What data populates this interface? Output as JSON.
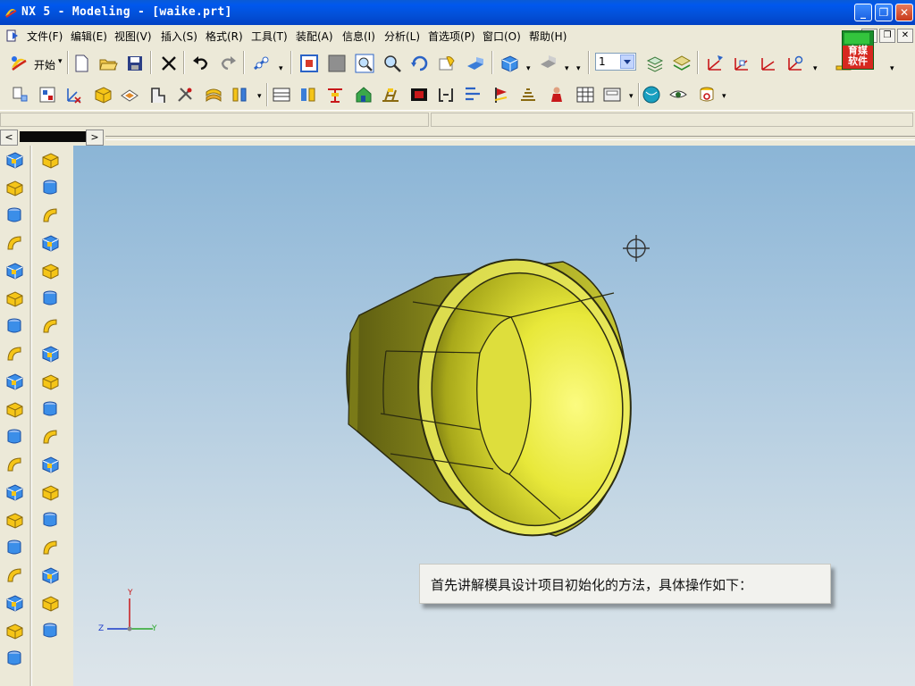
{
  "window": {
    "title": "NX 5 - Modeling - [waike.prt]",
    "buttons": [
      "_",
      "❐",
      "✕"
    ]
  },
  "menubar": {
    "items": [
      "文件(F)",
      "编辑(E)",
      "视图(V)",
      "插入(S)",
      "格式(R)",
      "工具(T)",
      "装配(A)",
      "信息(I)",
      "分析(L)",
      "首选项(P)",
      "窗口(O)",
      "帮助(H)"
    ]
  },
  "brand_badge": {
    "text": "育媒\n软件"
  },
  "toolbar1": {
    "start_label": "开始",
    "layer_value": "1",
    "icons": [
      "start-icon",
      "new-file-icon",
      "open-folder-icon",
      "save-icon",
      "delete-icon",
      "undo-icon",
      "redo-icon",
      "snap-icon",
      "fit-icon",
      "zoom-window-icon",
      "zoom-icon",
      "rotate-icon",
      "pan-icon",
      "perspective-icon",
      "shaded-cube-icon",
      "render-style-icon",
      "layer-settings-icon",
      "layer-visible-icon",
      "wcs-origin-icon",
      "wcs-dynamic-icon",
      "wcs-rotate-icon",
      "wcs-orient-icon",
      "brand-icon"
    ]
  },
  "toolbar2": {
    "icons": [
      "sketch-tool-icon",
      "extract-icon",
      "datum-csys-icon",
      "box-feature-icon",
      "plane-icon",
      "trim-icon",
      "tools-icon",
      "sheet-icon",
      "measure-icon",
      "section-icon",
      "pattern-icon",
      "cut-icon",
      "house-icon",
      "ladder-icon",
      "film-icon",
      "bracket-icon",
      "align-icon",
      "flag-icon",
      "stack-icon",
      "person-icon",
      "grid-icon",
      "frame-icon",
      "globe-icon",
      "eye-icon",
      "refresh-icon"
    ]
  },
  "left_palette": {
    "col1": [
      "sketch-icon",
      "extrude-icon",
      "revolve-icon",
      "sweep-icon",
      "block-icon",
      "cylinder-icon",
      "cone-icon",
      "sphere-icon",
      "hole-icon",
      "boss-icon",
      "pocket-icon",
      "pad-icon",
      "slot-icon",
      "groove-icon",
      "user-defined-icon",
      "cube-icon",
      "cylinder-body-icon",
      "cone-body-icon",
      "sphere-body-icon"
    ],
    "col2": [
      "point-icon",
      "rectangle-icon",
      "chamfer-icon",
      "edge-blend-icon",
      "face-blend-icon",
      "soft-blend-icon",
      "draft-icon",
      "offset-face-icon",
      "thread-icon",
      "instance-icon",
      "mirror-icon",
      "shell-icon",
      "split-icon",
      "trim-body-icon",
      "sew-icon",
      "patch-icon",
      "extract-body-icon",
      "promote-icon"
    ]
  },
  "viewport": {
    "caption": "首先讲解模具设计项目初始化的方法，具体操作如下：",
    "axis": {
      "x": "Z",
      "y": "Y",
      "z": "Y"
    },
    "model_color": "#E8E83A"
  }
}
